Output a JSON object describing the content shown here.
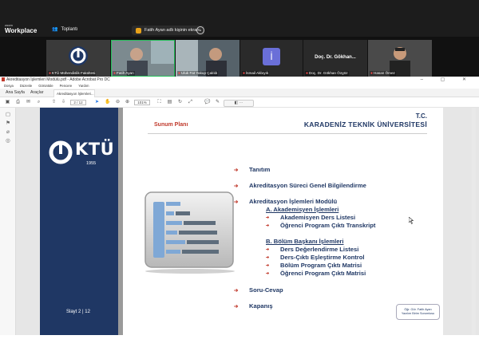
{
  "conference": {
    "brand_top": "zoom",
    "brand": "Workplace",
    "meetings_label": "Toplantı",
    "session_title": "Fatih Ayan adlı kişinin ekranı",
    "participants": [
      {
        "name": "KTÜ Mühendislik Fakültesi"
      },
      {
        "name": "Fatih Ayan"
      },
      {
        "name": "Uluk Fat Yakup Çalıldı"
      },
      {
        "name": "İsmail Akbıyık",
        "initial": "İ"
      },
      {
        "name": "Doç. Dr. Gökhan Özgöz",
        "header": "Doç. Dr. Gökhan..."
      },
      {
        "name": "Hasan Ömez"
      }
    ]
  },
  "acrobat": {
    "window_title": "Akreditasyon İşlemleri Modülü.pdf - Adobe Acrobat Pro DC",
    "menu": [
      "Dosya",
      "Düzenle",
      "Görüntüle",
      "Pencere",
      "Yardım"
    ],
    "tabs": [
      "Ana Sayfa",
      "Araçlar"
    ],
    "doc_tab": "Akreditasyon İşlemleri...",
    "page_indicator": "2 / 12",
    "zoom": "101%",
    "floatbar": "◧ ⋯"
  },
  "slide": {
    "plan_title": "Sunum Planı",
    "tc": "T.C.",
    "university": "KARADENİZ TEKNİK ÜNİVERSİTESİ",
    "logo_text": "KTÜ",
    "logo_year": "1955",
    "slide_counter": "Slayt 2 | 12",
    "stamp_line1": "Öğr. Gör. Fatih Ayan",
    "stamp_line2": "Yazılım Birim Sorumlusu",
    "agenda": {
      "item1": "Tanıtım",
      "item2": "Akreditasyon Süreci Genel Bilgilendirme",
      "item3": "Akreditasyon İşlemleri Modülü",
      "sub_a": "A. Akademisyen İşlemleri",
      "a1": "Akademisyen Ders Listesi",
      "a2": "Öğrenci Program Çıktı Transkript",
      "sub_b": "B. Bölüm Başkanı İşlemleri",
      "b1": "Ders Değerlendirme Listesi",
      "b2": "Ders-Çıktı Eşleştirme Kontrol",
      "b3": "Bölüm Program Çıktı Matrisi",
      "b4": "Öğrenci Program Çıktı Matrisi",
      "item4": "Soru-Cevap",
      "item5": "Kapanış"
    },
    "colors": {
      "navy": "#1f3764",
      "red": "#c0392b",
      "accent_green": "#26c05a"
    }
  }
}
